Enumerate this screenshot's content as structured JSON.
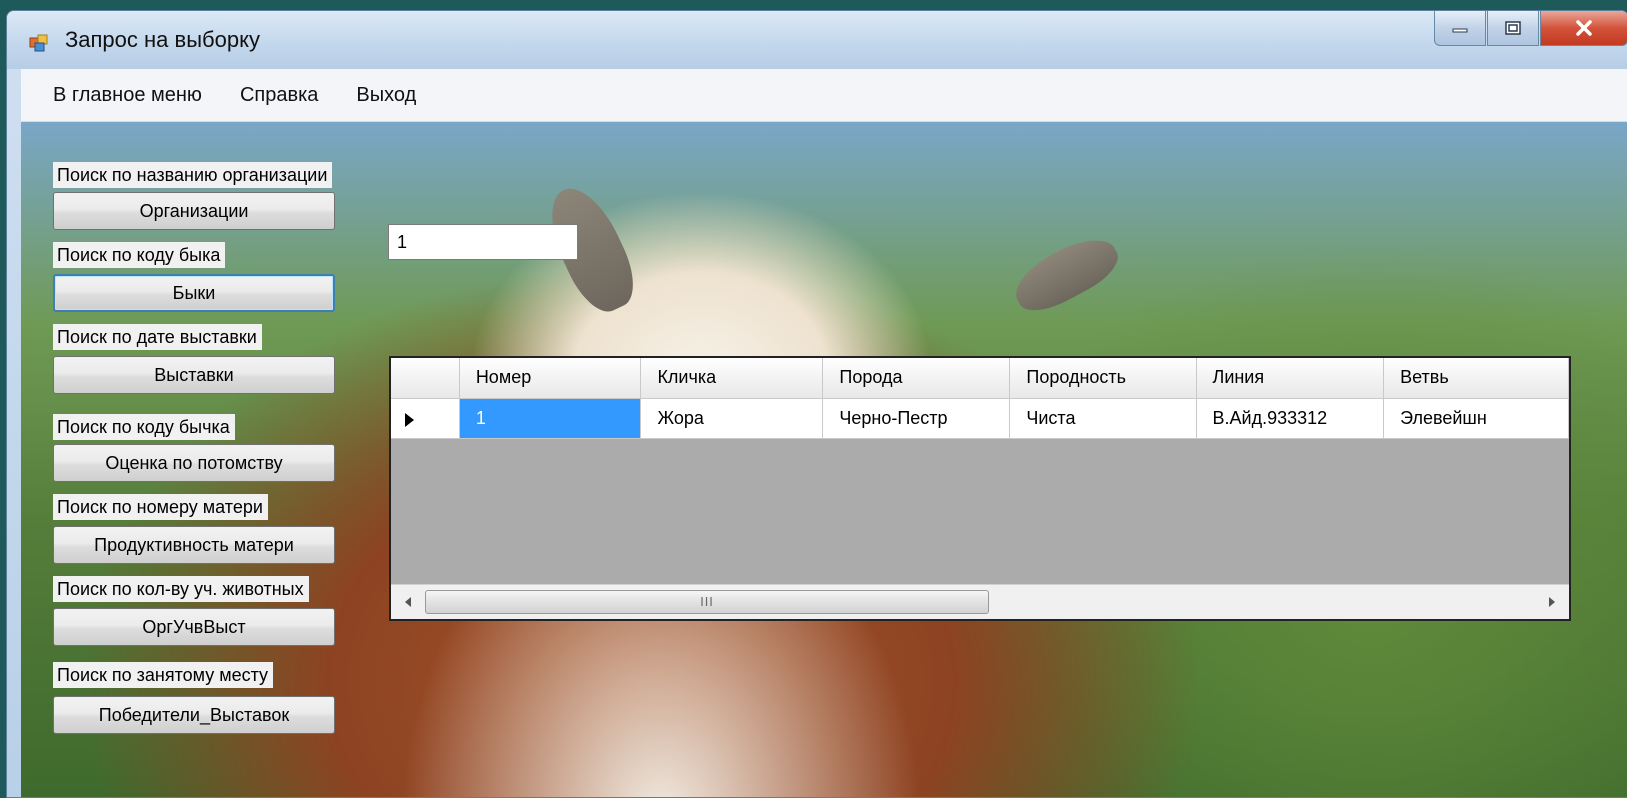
{
  "window": {
    "title": "Запрос на выборку",
    "icon": "app-window-icon"
  },
  "menu": [
    {
      "label": "В главное меню"
    },
    {
      "label": "Справка"
    },
    {
      "label": "Выход"
    }
  ],
  "search": {
    "input_value": "1",
    "sections": [
      {
        "label": "Поиск по названию организации",
        "button": "Организации"
      },
      {
        "label": "Поиск по коду быка",
        "button": "Быки"
      },
      {
        "label": "Поиск по дате выставки",
        "button": "Выставки"
      },
      {
        "label": "Поиск по коду бычка",
        "button": "Оценка по потомству"
      },
      {
        "label": "Поиск по номеру матери",
        "button": "Продуктивность матери"
      },
      {
        "label": "Поиск по кол-ву уч. животных",
        "button": "ОргУчвВыст"
      },
      {
        "label": "Поиск по занятому месту",
        "button": "Победители_Выставок"
      }
    ]
  },
  "grid": {
    "columns": [
      "Номер",
      "Кличка",
      "Порода",
      "Породность",
      "Линия",
      "Ветвь"
    ],
    "rows": [
      [
        "1",
        "Жора",
        "Черно-Пестр",
        "Чиста",
        "В.Айд.933312",
        "Элевейшн"
      ]
    ],
    "scroll_thumb_glyph": "III"
  }
}
